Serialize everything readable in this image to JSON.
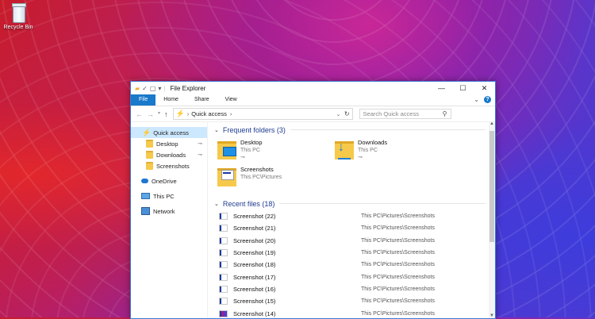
{
  "desktop": {
    "recycle_bin_label": "Recycle Bin"
  },
  "window": {
    "title": "File Explorer",
    "controls": {
      "minimize": "—",
      "maximize": "☐",
      "close": "✕"
    },
    "ribbon_tabs": [
      "File",
      "Home",
      "Share",
      "View"
    ],
    "address": "Quick access",
    "search_placeholder": "Search Quick access",
    "accent": "#1979ca"
  },
  "nav_pane": {
    "items": [
      {
        "label": "Quick access",
        "icon": "quick-access-icon"
      },
      {
        "label": "Desktop",
        "icon": "folder-icon"
      },
      {
        "label": "Downloads",
        "icon": "folder-icon"
      },
      {
        "label": "Screenshots",
        "icon": "folder-icon"
      },
      {
        "label": "OneDrive",
        "icon": "cloud-icon"
      },
      {
        "label": "This PC",
        "icon": "pc-icon"
      },
      {
        "label": "Network",
        "icon": "network-icon"
      }
    ]
  },
  "frequent": {
    "header": "Frequent folders (3)",
    "folders": [
      {
        "name": "Desktop",
        "location": "This PC"
      },
      {
        "name": "Downloads",
        "location": "This PC"
      },
      {
        "name": "Screenshots",
        "location": "This PC\\Pictures"
      }
    ]
  },
  "recent": {
    "header": "Recent files (18)",
    "files": [
      {
        "name": "Screenshot (22)",
        "path": "This PC\\Pictures\\Screenshots"
      },
      {
        "name": "Screenshot (21)",
        "path": "This PC\\Pictures\\Screenshots"
      },
      {
        "name": "Screenshot (20)",
        "path": "This PC\\Pictures\\Screenshots"
      },
      {
        "name": "Screenshot (19)",
        "path": "This PC\\Pictures\\Screenshots"
      },
      {
        "name": "Screenshot (18)",
        "path": "This PC\\Pictures\\Screenshots"
      },
      {
        "name": "Screenshot (17)",
        "path": "This PC\\Pictures\\Screenshots"
      },
      {
        "name": "Screenshot (16)",
        "path": "This PC\\Pictures\\Screenshots"
      },
      {
        "name": "Screenshot (15)",
        "path": "This PC\\Pictures\\Screenshots"
      },
      {
        "name": "Screenshot (14)",
        "path": "This PC\\Pictures\\Screenshots"
      }
    ]
  }
}
